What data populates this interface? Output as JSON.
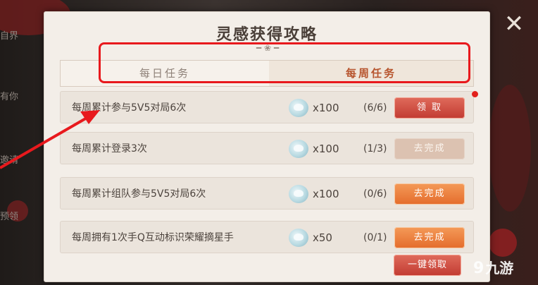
{
  "background": {
    "side_labels": [
      "自界",
      "有你",
      "邀请",
      "预领"
    ]
  },
  "dialog": {
    "title": "灵感获得攻略",
    "close_icon": "close-icon"
  },
  "tabs": [
    {
      "label": "每日任务",
      "active": false
    },
    {
      "label": "每周任务",
      "active": true
    }
  ],
  "tasks": [
    {
      "name": "每周累计参与5V5对局6次",
      "reward_icon": "inspiration-icon",
      "reward_qty": "x100",
      "progress": "(6/6)",
      "button": "领 取",
      "state": "claim",
      "red_dot": true
    },
    {
      "name": "每周累计登录3次",
      "reward_icon": "inspiration-icon",
      "reward_qty": "x100",
      "progress": "(1/3)",
      "button": "去完成",
      "state": "disabled",
      "red_dot": false
    },
    {
      "name": "每周累计组队参与5V5对局6次",
      "reward_icon": "inspiration-icon",
      "reward_qty": "x100",
      "progress": "(0/6)",
      "button": "去完成",
      "state": "goto",
      "red_dot": false
    },
    {
      "name": "每周拥有1次手Q互动标识荣耀摘星手",
      "reward_icon": "inspiration-icon",
      "reward_qty": "x50",
      "progress": "(0/1)",
      "button": "去完成",
      "state": "goto",
      "red_dot": false
    }
  ],
  "claim_all_label": "一键领取",
  "watermark": {
    "mark": "9",
    "text": "九游"
  },
  "colors": {
    "highlight": "#e8191d",
    "active_tab": "#b7542d",
    "claim": "#c23b32",
    "goto": "#e46c2c"
  }
}
